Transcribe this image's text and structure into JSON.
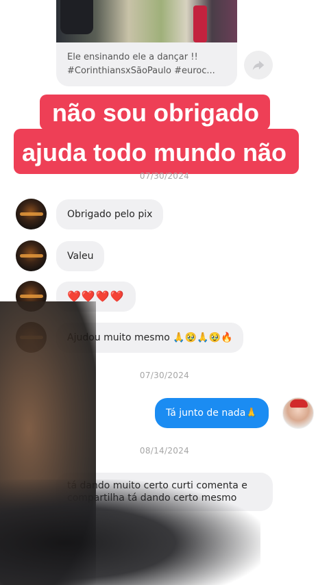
{
  "shared_post": {
    "caption_line_1": "Ele ensinando ele a dançar !!",
    "caption_line_2": "#CorinthiansxSãoPaulo #euroc..."
  },
  "overlay_text": {
    "line_1": "não sou obrigado",
    "line_2": "ajuda todo mundo não"
  },
  "dates": {
    "first": "07/30/2024",
    "second": "07/30/2024",
    "third": "08/14/2024"
  },
  "messages": [
    {
      "sender": "them",
      "text": "Obrigado pelo pix"
    },
    {
      "sender": "them",
      "text": "Valeu"
    },
    {
      "sender": "them",
      "text": "❤️❤️❤️❤️"
    },
    {
      "sender": "them",
      "text": "Ajudou muito mesmo 🙏🥹🙏🥹🔥"
    },
    {
      "sender": "me",
      "text": "Tá junto de nada🙏"
    },
    {
      "sender": "them",
      "text_line_1": "tá dando muito certo curti comenta e",
      "text_line_2": "compartilha tá dando certo mesmo"
    }
  ],
  "icons": {
    "share": "share-arrow-icon"
  },
  "colors": {
    "overlay_red": "#ee3f56",
    "my_bubble": "#1b8cf2",
    "their_bubble": "#f0f0f2",
    "date_gray": "#a5a5a5"
  }
}
